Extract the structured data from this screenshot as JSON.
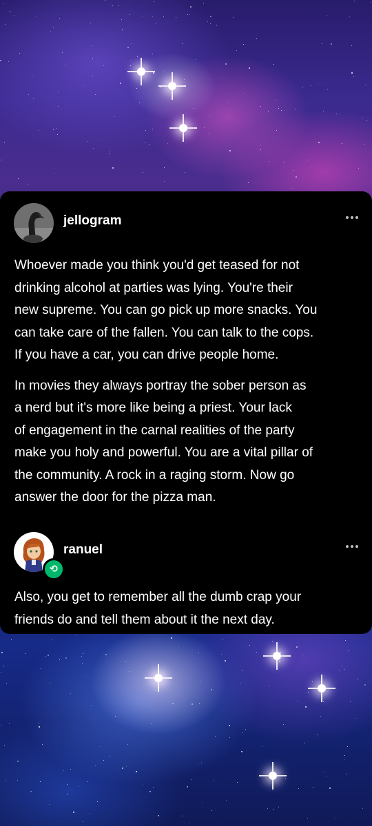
{
  "posts": [
    {
      "username": "jellogram",
      "avatar_icon": "goose-avatar",
      "paragraphs": [
        "Whoever made you think you'd get teased for not\ndrinking alcohol at parties was lying. You're their\nnew supreme. You can go pick up more snacks. You\ncan take care of the fallen. You can talk to the cops.\nIf you have a car, you can drive people home.",
        "In movies they always portray the sober person as\na nerd but it's more like being a priest. Your lack\nof engagement in the carnal realities of the party\nmake you holy and powerful. You are a vital pillar of\nthe community. A rock in a raging storm. Now go\nanswer the door for the pizza man."
      ]
    },
    {
      "username": "ranuel",
      "avatar_icon": "anime-character-avatar",
      "badge_icon": "reblog-icon",
      "paragraphs": [
        "Also, you get to remember all the dumb crap your\nfriends do and tell them about it the next day."
      ]
    }
  ],
  "colors": {
    "card_background": "#000000",
    "reblog_badge": "#00b86b",
    "text": "#ffffff"
  }
}
